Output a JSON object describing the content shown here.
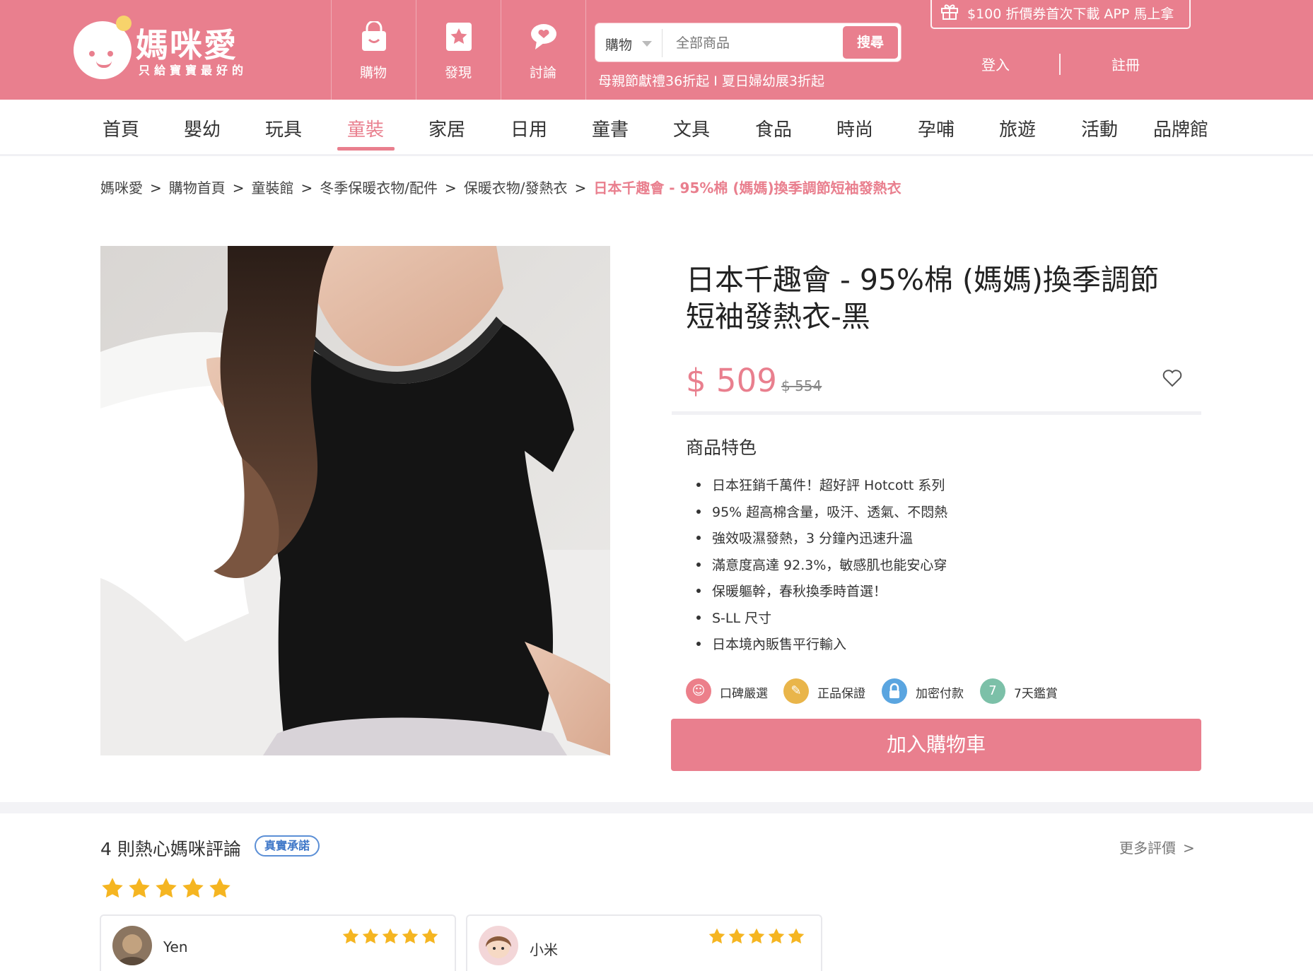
{
  "header": {
    "logo_title": "媽咪愛",
    "logo_subtitle": "只給寶寶最好的",
    "nav": [
      {
        "label": "購物",
        "icon": "shopping-bag-icon"
      },
      {
        "label": "發現",
        "icon": "discover-star-icon"
      },
      {
        "label": "討論",
        "icon": "chat-heart-icon"
      }
    ],
    "search": {
      "category": "購物",
      "placeholder": "全部商品",
      "button": "搜尋"
    },
    "promo_text": "母親節獻禮36折起 I 夏日婦幼展3折起",
    "coupon_text": "$100 折價券首次下載 APP 馬上拿",
    "login": "登入",
    "register": "註冊"
  },
  "categories": {
    "items": [
      "首頁",
      "嬰幼",
      "玩具",
      "童裝",
      "家居",
      "日用",
      "童書",
      "文具",
      "食品",
      "時尚",
      "孕哺",
      "旅遊",
      "活動",
      "品牌館"
    ],
    "active": "童裝"
  },
  "breadcrumb": {
    "items": [
      "媽咪愛",
      "購物首頁",
      "童裝館",
      "冬季保暖衣物/配件",
      "保暖衣物/發熱衣"
    ],
    "current": "日本千趣會 - 95%棉 (媽媽)換季調節短袖發熱衣"
  },
  "product": {
    "title": "日本千趣會 - 95%棉 (媽媽)換季調節短袖發熱衣-黑",
    "price": "$ 509",
    "original_price": "$ 554",
    "features_heading": "商品特色",
    "features": [
      "日本狂銷千萬件！超好評 Hotcott 系列",
      "95% 超高棉含量，吸汗、透氣、不悶熱",
      "強效吸濕發熱，3 分鐘內迅速升溫",
      "滿意度高達 92.3%，敏感肌也能安心穿",
      "保暖軀幹，春秋換季時首選！",
      "S-LL 尺寸",
      "日本境內販售平行輸入"
    ],
    "badges": [
      {
        "label": "口碑嚴選",
        "color": "#ec7f8a"
      },
      {
        "label": "正品保證",
        "color": "#e9b54a"
      },
      {
        "label": "加密付款",
        "color": "#5aa5e0"
      },
      {
        "label": "7天鑑賞",
        "color": "#7cc0a8"
      }
    ],
    "add_to_cart": "加入購物車"
  },
  "reviews": {
    "heading": "4 則熱心媽咪評論",
    "tag": "真實承諾",
    "more": "更多評價",
    "rating": 5,
    "star_color": "#f5b521",
    "cards": [
      {
        "name": "Yen",
        "rating": 5
      },
      {
        "name": "小米",
        "rating": 5
      }
    ]
  },
  "colors": {
    "brand": "#e97f8e",
    "text": "#333333"
  }
}
